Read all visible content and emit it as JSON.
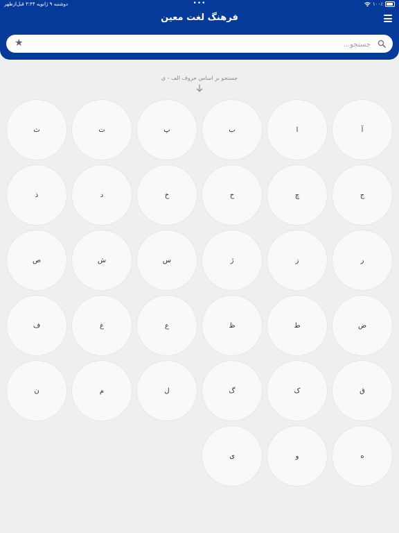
{
  "status": {
    "datetime": "دوشنبه ۹ ژانویه ۳:۴۴ قبل‌ازظهر",
    "dots": "•••",
    "battery": "۱۰۰٪"
  },
  "header": {
    "title": "فرهنگ لغت معین"
  },
  "search": {
    "placeholder": "جستجو..."
  },
  "hint": "جستجو بر اساس حروف الف - ی",
  "letters": [
    "آ",
    "ا",
    "ب",
    "پ",
    "ت",
    "ث",
    "ج",
    "چ",
    "ح",
    "خ",
    "د",
    "ذ",
    "ر",
    "ز",
    "ژ",
    "س",
    "ش",
    "ص",
    "ض",
    "ط",
    "ظ",
    "ع",
    "غ",
    "ف",
    "ق",
    "ک",
    "گ",
    "ل",
    "م",
    "ن",
    "ه",
    "و",
    "ی"
  ],
  "colors": {
    "header": "#063a9a",
    "background": "#efefef",
    "circle": "#f9f9f9"
  },
  "icons": {
    "menu": "menu-icon",
    "search": "search-icon",
    "favorites": "star-icon",
    "arrow": "arrow-down-icon"
  }
}
